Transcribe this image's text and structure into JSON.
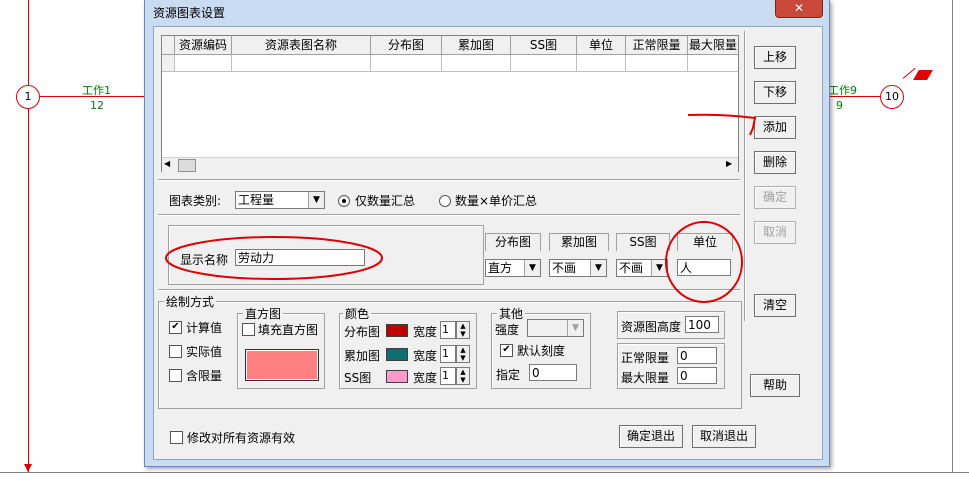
{
  "background": {
    "node_left": "1",
    "node_right": "10",
    "work_left_name": "工作1",
    "work_left_value": "12",
    "work_right_name": "工作9",
    "work_right_value": "9"
  },
  "dialog": {
    "title": "资源图表设置",
    "close_label": "✕",
    "grid": {
      "headers": [
        "资源编码",
        "资源表图名称",
        "分布图",
        "累加图",
        "SS图",
        "单位",
        "正常限量",
        "最大限量"
      ]
    },
    "side_buttons": {
      "move_up": "上移",
      "move_down": "下移",
      "add": "添加",
      "delete": "删除",
      "confirm": "确定",
      "cancel": "取消",
      "clear": "清空",
      "help": "帮助"
    },
    "chart_type_label": "图表类别:",
    "chart_type_value": "工程量",
    "radio_quantity": "仅数量汇总",
    "radio_amount": "数量×单价汇总",
    "display_name_label": "显示名称",
    "display_name_value": "劳动力",
    "col_tabs": [
      "分布图",
      "累加图",
      "SS图",
      "单位"
    ],
    "col_values": [
      "直方",
      "不画",
      "不画",
      "人"
    ],
    "draw_method_label": "绘制方式",
    "calc_value": "计算值",
    "actual_value": "实际值",
    "with_limit": "含限量",
    "histogram_label": "直方图",
    "fill_histogram": "填充直方图",
    "color_label": "颜色",
    "color_rows": [
      {
        "name": "分布图",
        "width_label": "宽度",
        "width": "1",
        "color": "#c00000"
      },
      {
        "name": "累加图",
        "width_label": "宽度",
        "width": "1",
        "color": "#0c6f6f"
      },
      {
        "name": "SS图",
        "width_label": "宽度",
        "width": "1",
        "color": "#ff99cc"
      }
    ],
    "histogram_color": "#ff8080",
    "other_label": "其他",
    "intensity_label": "强度",
    "default_scale": "默认刻度",
    "specify_label": "指定",
    "specify_value": "0",
    "chart_height_label": "资源图高度",
    "chart_height_value": "100",
    "normal_limit_label": "正常限量",
    "normal_limit_value": "0",
    "max_limit_label": "最大限量",
    "max_limit_value": "0",
    "apply_all_label": "修改对所有资源有效",
    "ok_exit": "确定退出",
    "cancel_exit": "取消退出"
  },
  "colors": {
    "annotation_red": "#e00000"
  }
}
